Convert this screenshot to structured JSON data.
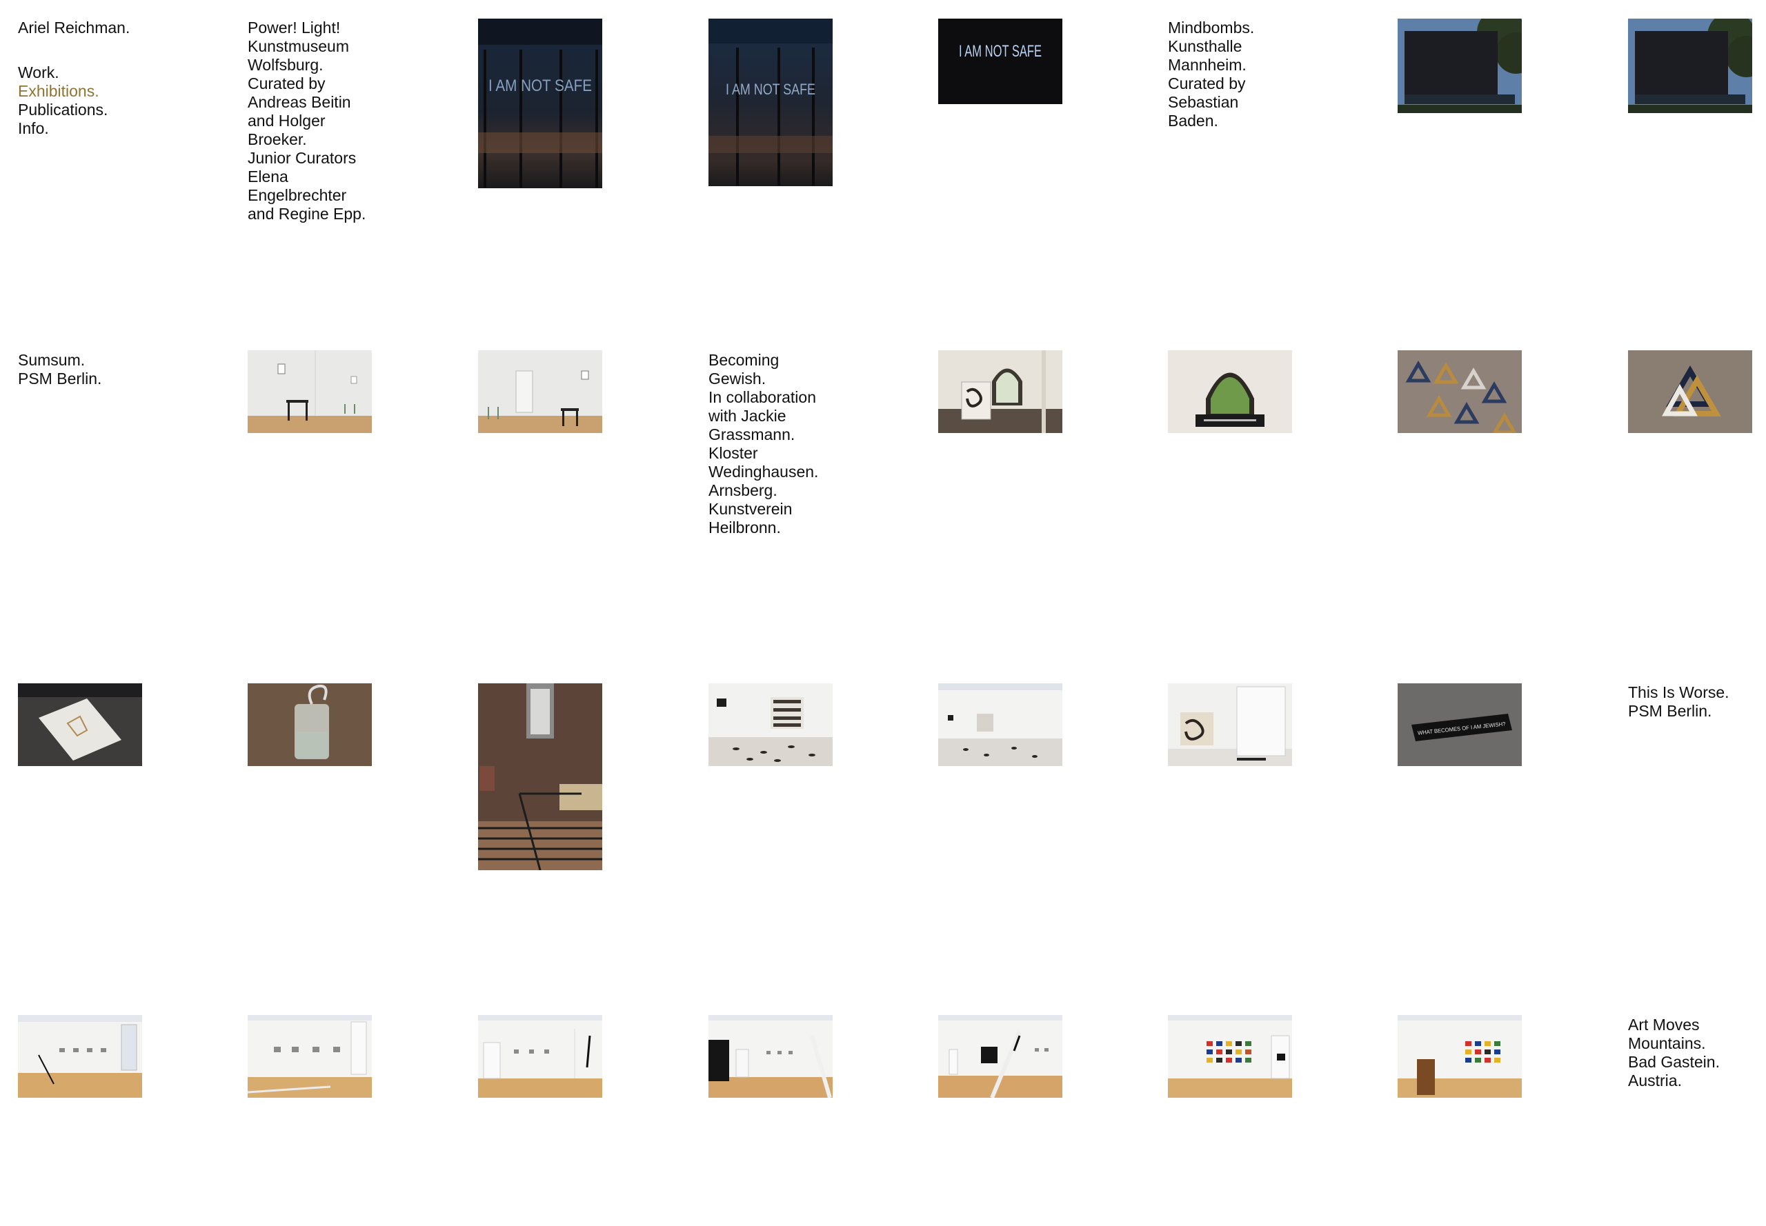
{
  "site": {
    "title": "Ariel Reichman."
  },
  "nav": {
    "items": [
      "Work.",
      "Exhibitions.",
      "Publications.",
      "Info."
    ],
    "active": "Exhibitions.",
    "active_color": "#8f7332"
  },
  "exhibitions": [
    {
      "lines": [
        "Power! Light!",
        "Kunstmuseum",
        "Wolfsburg.",
        "Curated by",
        "Andreas Beitin",
        "and Holger",
        "Broeker.",
        "Junior Curators",
        "Elena",
        "Engelbrechter",
        "and Regine Epp."
      ]
    },
    {
      "lines": [
        "Mindbombs.",
        "Kunsthalle",
        "Mannheim.",
        "Curated by",
        "Sebastian",
        "Baden."
      ]
    },
    {
      "lines": [
        "Sumsum.",
        "PSM Berlin."
      ]
    },
    {
      "lines": [
        "Becoming",
        "Gewish.",
        "In collaboration",
        "with Jackie",
        "Grassmann.",
        "Kloster",
        "Wedinghausen.",
        "Arnsberg.",
        "Kunstverein",
        "Heilbronn."
      ]
    },
    {
      "lines": [
        "This Is Worse.",
        "PSM Berlin."
      ]
    },
    {
      "lines": [
        "Art Moves",
        "Mountains.",
        "Bad Gastein.",
        "Austria."
      ]
    }
  ],
  "artwork_text": {
    "neon": "I AM NOT SAFE",
    "floor_sign": "WHAT BECOMES OF I AM JEWISH?"
  }
}
